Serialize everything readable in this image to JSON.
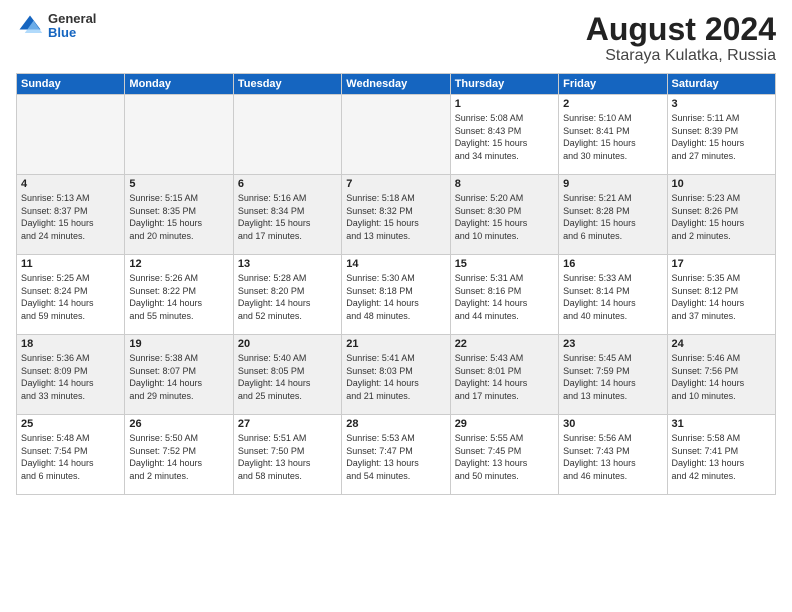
{
  "header": {
    "logo_general": "General",
    "logo_blue": "Blue",
    "title": "August 2024",
    "subtitle": "Staraya Kulatka, Russia"
  },
  "weekdays": [
    "Sunday",
    "Monday",
    "Tuesday",
    "Wednesday",
    "Thursday",
    "Friday",
    "Saturday"
  ],
  "weeks": [
    [
      {
        "day": "",
        "info": "",
        "empty": true
      },
      {
        "day": "",
        "info": "",
        "empty": true
      },
      {
        "day": "",
        "info": "",
        "empty": true
      },
      {
        "day": "",
        "info": "",
        "empty": true
      },
      {
        "day": "1",
        "info": "Sunrise: 5:08 AM\nSunset: 8:43 PM\nDaylight: 15 hours\nand 34 minutes.",
        "empty": false
      },
      {
        "day": "2",
        "info": "Sunrise: 5:10 AM\nSunset: 8:41 PM\nDaylight: 15 hours\nand 30 minutes.",
        "empty": false
      },
      {
        "day": "3",
        "info": "Sunrise: 5:11 AM\nSunset: 8:39 PM\nDaylight: 15 hours\nand 27 minutes.",
        "empty": false
      }
    ],
    [
      {
        "day": "4",
        "info": "Sunrise: 5:13 AM\nSunset: 8:37 PM\nDaylight: 15 hours\nand 24 minutes.",
        "empty": false
      },
      {
        "day": "5",
        "info": "Sunrise: 5:15 AM\nSunset: 8:35 PM\nDaylight: 15 hours\nand 20 minutes.",
        "empty": false
      },
      {
        "day": "6",
        "info": "Sunrise: 5:16 AM\nSunset: 8:34 PM\nDaylight: 15 hours\nand 17 minutes.",
        "empty": false
      },
      {
        "day": "7",
        "info": "Sunrise: 5:18 AM\nSunset: 8:32 PM\nDaylight: 15 hours\nand 13 minutes.",
        "empty": false
      },
      {
        "day": "8",
        "info": "Sunrise: 5:20 AM\nSunset: 8:30 PM\nDaylight: 15 hours\nand 10 minutes.",
        "empty": false
      },
      {
        "day": "9",
        "info": "Sunrise: 5:21 AM\nSunset: 8:28 PM\nDaylight: 15 hours\nand 6 minutes.",
        "empty": false
      },
      {
        "day": "10",
        "info": "Sunrise: 5:23 AM\nSunset: 8:26 PM\nDaylight: 15 hours\nand 2 minutes.",
        "empty": false
      }
    ],
    [
      {
        "day": "11",
        "info": "Sunrise: 5:25 AM\nSunset: 8:24 PM\nDaylight: 14 hours\nand 59 minutes.",
        "empty": false
      },
      {
        "day": "12",
        "info": "Sunrise: 5:26 AM\nSunset: 8:22 PM\nDaylight: 14 hours\nand 55 minutes.",
        "empty": false
      },
      {
        "day": "13",
        "info": "Sunrise: 5:28 AM\nSunset: 8:20 PM\nDaylight: 14 hours\nand 52 minutes.",
        "empty": false
      },
      {
        "day": "14",
        "info": "Sunrise: 5:30 AM\nSunset: 8:18 PM\nDaylight: 14 hours\nand 48 minutes.",
        "empty": false
      },
      {
        "day": "15",
        "info": "Sunrise: 5:31 AM\nSunset: 8:16 PM\nDaylight: 14 hours\nand 44 minutes.",
        "empty": false
      },
      {
        "day": "16",
        "info": "Sunrise: 5:33 AM\nSunset: 8:14 PM\nDaylight: 14 hours\nand 40 minutes.",
        "empty": false
      },
      {
        "day": "17",
        "info": "Sunrise: 5:35 AM\nSunset: 8:12 PM\nDaylight: 14 hours\nand 37 minutes.",
        "empty": false
      }
    ],
    [
      {
        "day": "18",
        "info": "Sunrise: 5:36 AM\nSunset: 8:09 PM\nDaylight: 14 hours\nand 33 minutes.",
        "empty": false
      },
      {
        "day": "19",
        "info": "Sunrise: 5:38 AM\nSunset: 8:07 PM\nDaylight: 14 hours\nand 29 minutes.",
        "empty": false
      },
      {
        "day": "20",
        "info": "Sunrise: 5:40 AM\nSunset: 8:05 PM\nDaylight: 14 hours\nand 25 minutes.",
        "empty": false
      },
      {
        "day": "21",
        "info": "Sunrise: 5:41 AM\nSunset: 8:03 PM\nDaylight: 14 hours\nand 21 minutes.",
        "empty": false
      },
      {
        "day": "22",
        "info": "Sunrise: 5:43 AM\nSunset: 8:01 PM\nDaylight: 14 hours\nand 17 minutes.",
        "empty": false
      },
      {
        "day": "23",
        "info": "Sunrise: 5:45 AM\nSunset: 7:59 PM\nDaylight: 14 hours\nand 13 minutes.",
        "empty": false
      },
      {
        "day": "24",
        "info": "Sunrise: 5:46 AM\nSunset: 7:56 PM\nDaylight: 14 hours\nand 10 minutes.",
        "empty": false
      }
    ],
    [
      {
        "day": "25",
        "info": "Sunrise: 5:48 AM\nSunset: 7:54 PM\nDaylight: 14 hours\nand 6 minutes.",
        "empty": false
      },
      {
        "day": "26",
        "info": "Sunrise: 5:50 AM\nSunset: 7:52 PM\nDaylight: 14 hours\nand 2 minutes.",
        "empty": false
      },
      {
        "day": "27",
        "info": "Sunrise: 5:51 AM\nSunset: 7:50 PM\nDaylight: 13 hours\nand 58 minutes.",
        "empty": false
      },
      {
        "day": "28",
        "info": "Sunrise: 5:53 AM\nSunset: 7:47 PM\nDaylight: 13 hours\nand 54 minutes.",
        "empty": false
      },
      {
        "day": "29",
        "info": "Sunrise: 5:55 AM\nSunset: 7:45 PM\nDaylight: 13 hours\nand 50 minutes.",
        "empty": false
      },
      {
        "day": "30",
        "info": "Sunrise: 5:56 AM\nSunset: 7:43 PM\nDaylight: 13 hours\nand 46 minutes.",
        "empty": false
      },
      {
        "day": "31",
        "info": "Sunrise: 5:58 AM\nSunset: 7:41 PM\nDaylight: 13 hours\nand 42 minutes.",
        "empty": false
      }
    ]
  ]
}
